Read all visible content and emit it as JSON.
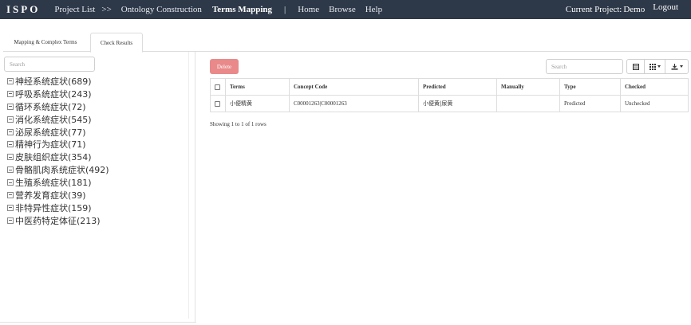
{
  "navbar": {
    "brand": "ISPO",
    "items": [
      {
        "label": "Project List",
        "active": false
      },
      {
        "label": ">>",
        "active": false
      },
      {
        "label": "Ontology Construction",
        "active": false
      },
      {
        "label": "Terms Mapping",
        "active": true
      },
      {
        "label": "|",
        "active": false
      },
      {
        "label": "Home",
        "active": false
      },
      {
        "label": "Browse",
        "active": false
      },
      {
        "label": "Help",
        "active": false
      }
    ],
    "current_project_label": "Current Project:",
    "current_project": "Demo",
    "logout": "Logout"
  },
  "tabs": [
    {
      "label": "Mapping & Complex Terms",
      "active": false
    },
    {
      "label": "Check Results",
      "active": true
    }
  ],
  "left": {
    "search_placeholder": "Search",
    "tree": [
      "神经系统症状(689)",
      "呼吸系统症状(243)",
      "循环系统症状(72)",
      "消化系统症状(545)",
      "泌尿系统症状(77)",
      "精神行为症状(71)",
      "皮肤组织症状(354)",
      "骨骼肌肉系统症状(492)",
      "生殖系统症状(181)",
      "营养发育症状(39)",
      "非特异性症状(159)",
      "中医药特定体征(213)"
    ]
  },
  "right": {
    "delete_label": "Delete",
    "search_placeholder": "Search",
    "table": {
      "headers": [
        "Terms",
        "Concept Code",
        "Predicted",
        "Manually",
        "Type",
        "Checked"
      ],
      "rows": [
        {
          "terms": "小便精黄",
          "concept_code": "C00001263|C00001263",
          "predicted": "小便黄|尿黄",
          "manually": "",
          "type": "Predicted",
          "checked": "Unchecked"
        }
      ]
    },
    "rows_info": "Showing 1 to 1 of 1 rows"
  },
  "icons": {
    "tree_toggle": "minus-square-icon",
    "tool_1": "list-icon",
    "tool_2": "grid-columns-icon",
    "tool_3": "export-icon"
  },
  "colors": {
    "navbar_bg": "#2d3848",
    "delete_bg": "#e9898a"
  }
}
